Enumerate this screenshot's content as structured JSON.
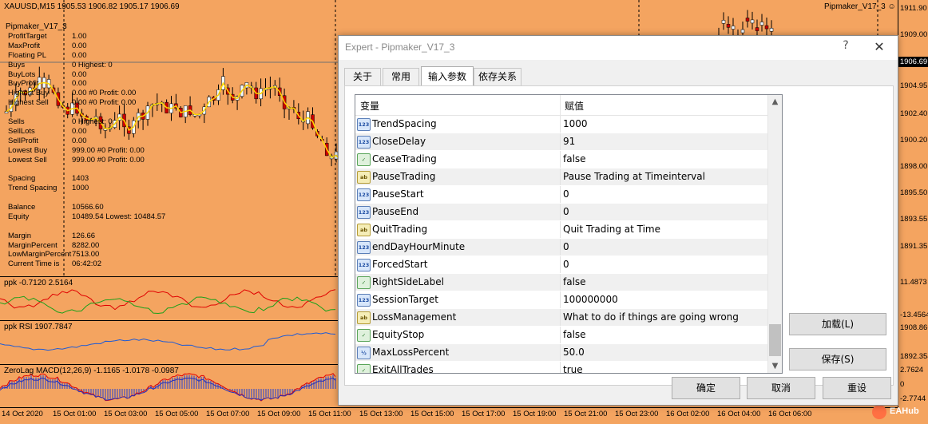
{
  "chart": {
    "title": "XAUUSD,M15  1905.53 1906.82 1905.17 1906.69",
    "ea_name": "Pipmaker_V17_3",
    "ea_panel_title": "Pipmaker_V17_3",
    "stats": [
      {
        "label": "ProfitTarget",
        "value": "1.00",
        "extra": ""
      },
      {
        "label": "MaxProfit",
        "value": "0.00",
        "extra": ""
      },
      {
        "label": "Floating PL",
        "value": "0.00",
        "extra": ""
      },
      {
        "label": "Buys",
        "value": "0   Highest: 0",
        "extra": ""
      },
      {
        "label": "BuyLots",
        "value": "0.00",
        "extra": ""
      },
      {
        "label": "BuyProfit",
        "value": "0.00",
        "extra": ""
      },
      {
        "label": "Highest Buy",
        "value": "0.00 #0  Profit: 0.00",
        "extra": ""
      },
      {
        "label": "Highest Sell",
        "value": "0.00 #0  Profit: 0.00",
        "extra": ""
      },
      {
        "label": "",
        "value": "",
        "extra": ""
      },
      {
        "label": "Sells",
        "value": "0   Highest: 0",
        "extra": ""
      },
      {
        "label": "SellLots",
        "value": "0.00",
        "extra": ""
      },
      {
        "label": "SellProfit",
        "value": "0.00",
        "extra": ""
      },
      {
        "label": "Lowest Buy",
        "value": "999.00 #0  Profit: 0.00",
        "extra": ""
      },
      {
        "label": "Lowest Sell",
        "value": "999.00 #0  Profit: 0.00",
        "extra": ""
      },
      {
        "label": "",
        "value": "",
        "extra": ""
      },
      {
        "label": "Spacing",
        "value": "1403",
        "extra": ""
      },
      {
        "label": "Trend Spacing",
        "value": "1000",
        "extra": ""
      },
      {
        "label": "",
        "value": "",
        "extra": ""
      },
      {
        "label": "Balance",
        "value": "10566.60",
        "extra": ""
      },
      {
        "label": "Equity",
        "value": "10489.54  Lowest: 10484.57",
        "extra": ""
      },
      {
        "label": "",
        "value": "",
        "extra": ""
      },
      {
        "label": "Margin",
        "value": "126.66",
        "extra": ""
      },
      {
        "label": "MarginPercent",
        "value": "8282.00",
        "extra": ""
      },
      {
        "label": "LowMarginPercent",
        "value": "7513.00",
        "extra": ""
      },
      {
        "label": "Current Time is",
        "value": "06:42:02",
        "extra": ""
      }
    ],
    "price_ticks": [
      "1911.90",
      "1909.00",
      "1904.95",
      "1902.40",
      "1900.20",
      "1898.00",
      "1895.50",
      "1893.55",
      "1891.35"
    ],
    "current_price": "1906.69",
    "sub1_title": "ppk -0.7120 2.5164",
    "sub1_ticks": [
      "11.4873",
      "-13.4564"
    ],
    "sub2_title": "ppk RSI 1907.7847",
    "sub2_ticks": [
      "1908.8664",
      "1892.3546"
    ],
    "sub3_title": "ZeroLag MACD(12,26,9) -1.1165 -1.0178 -0.0987",
    "sub3_ticks": [
      "2.7624",
      "0",
      "-2.7744"
    ],
    "time_labels": [
      "14 Oct 2020",
      "15 Oct 01:00",
      "15 Oct 03:00",
      "15 Oct 05:00",
      "15 Oct 07:00",
      "15 Oct 09:00",
      "15 Oct 11:00",
      "15 Oct 13:00",
      "15 Oct 15:00",
      "15 Oct 17:00",
      "15 Oct 19:00",
      "15 Oct 21:00",
      "15 Oct 23:00",
      "16 Oct 02:00",
      "16 Oct 04:00",
      "16 Oct 06:00"
    ],
    "watermark": "EAHub"
  },
  "dialog": {
    "title": "Expert - Pipmaker_V17_3",
    "help": "?",
    "close": "✕",
    "tabs": [
      {
        "label": "关于",
        "active": false
      },
      {
        "label": "常用",
        "active": false
      },
      {
        "label": "输入参数",
        "active": true
      },
      {
        "label": "依存关系",
        "active": false
      }
    ],
    "grid_headers": {
      "variable": "变量",
      "value": "赋值"
    },
    "params": [
      {
        "type": "int",
        "icon": "123",
        "name": "TrendSpacing",
        "value": "1000"
      },
      {
        "type": "int",
        "icon": "123",
        "name": "CloseDelay",
        "value": "91"
      },
      {
        "type": "bool",
        "icon": "✓",
        "name": "CeaseTrading",
        "value": "false"
      },
      {
        "type": "abc",
        "icon": "ab",
        "name": "PauseTrading",
        "value": "Pause Trading at Timeinterval"
      },
      {
        "type": "int",
        "icon": "123",
        "name": "PauseStart",
        "value": "0"
      },
      {
        "type": "int",
        "icon": "123",
        "name": "PauseEnd",
        "value": "0"
      },
      {
        "type": "abc",
        "icon": "ab",
        "name": "QuitTrading",
        "value": "Quit Trading at Time"
      },
      {
        "type": "int",
        "icon": "123",
        "name": "endDayHourMinute",
        "value": "0"
      },
      {
        "type": "int",
        "icon": "123",
        "name": "ForcedStart",
        "value": "0"
      },
      {
        "type": "bool",
        "icon": "✓",
        "name": "RightSideLabel",
        "value": "false"
      },
      {
        "type": "int",
        "icon": "123",
        "name": "SessionTarget",
        "value": "100000000"
      },
      {
        "type": "abc",
        "icon": "ab",
        "name": "LossManagement",
        "value": "What to do if things are going wrong"
      },
      {
        "type": "bool",
        "icon": "✓",
        "name": "EquityStop",
        "value": "false"
      },
      {
        "type": "dbl",
        "icon": "½",
        "name": "MaxLossPercent",
        "value": "50.0"
      },
      {
        "type": "bool",
        "icon": "✓",
        "name": "ExitAllTrades",
        "value": "true"
      }
    ],
    "load_button": "加载(L)",
    "save_button": "保存(S)",
    "ok_button": "确定",
    "cancel_button": "取消",
    "reset_button": "重设"
  },
  "colors": {
    "chart_bg": "#f4a460",
    "bull_candle": "#f0f8ff",
    "bear_candle": "#cc0000",
    "ma_line": "#ffd700"
  }
}
